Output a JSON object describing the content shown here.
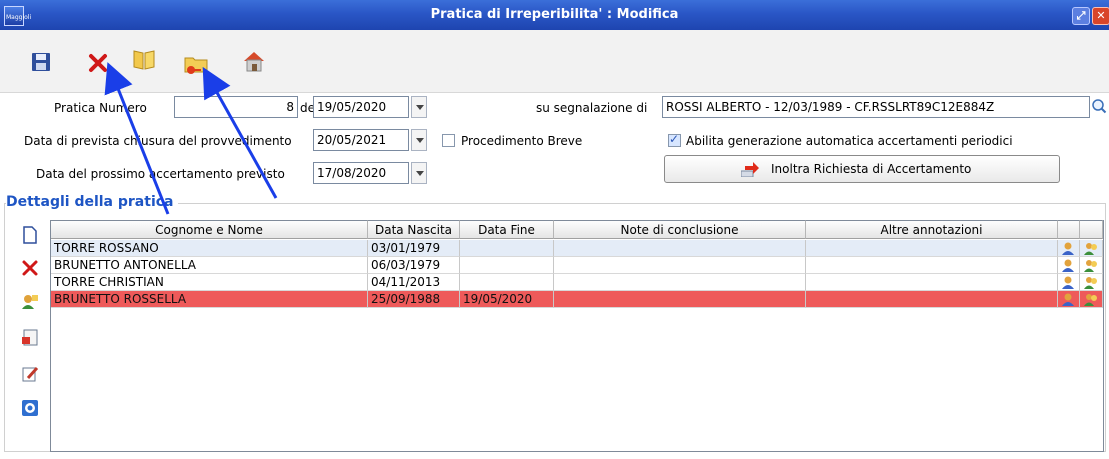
{
  "window": {
    "title": "Pratica di Irreperibilita' : Modifica",
    "app_icon_text": "Maggioli"
  },
  "toolbar": {
    "items": [
      {
        "name": "save-icon"
      },
      {
        "name": "delete-icon"
      },
      {
        "name": "open-book-icon"
      },
      {
        "name": "folder-key-icon"
      },
      {
        "name": "home-icon"
      }
    ]
  },
  "form": {
    "numero_label": "Pratica Numero",
    "numero_value": "8",
    "del_label": "del",
    "del_value": "19/05/2020",
    "segnalazione_label": "su segnalazione di",
    "segnalazione_value": "ROSSI ALBERTO - 12/03/1989 - CF.RSSLRT89C12E884Z",
    "chiusura_label": "Data di prevista chiusura del provvedimento",
    "chiusura_value": "20/05/2021",
    "breve_label": "Procedimento Breve",
    "breve_checked": false,
    "abilita_label": "Abilita generazione automatica accertamenti periodici",
    "abilita_checked": true,
    "prossimo_label": "Data del prossimo accertamento previsto",
    "prossimo_value": "17/08/2020",
    "inoltra_label": "Inoltra Richiesta di Accertamento"
  },
  "section": {
    "title": "Dettagli della pratica"
  },
  "grid": {
    "columns": [
      "Cognome e Nome",
      "Data Nascita",
      "Data Fine",
      "Note di conclusione",
      "Altre annotazioni"
    ],
    "rows": [
      {
        "nome": "TORRE ROSSANO",
        "nascita": "03/01/1979",
        "fine": "",
        "note": "",
        "altre": ""
      },
      {
        "nome": "BRUNETTO ANTONELLA",
        "nascita": "06/03/1979",
        "fine": "",
        "note": "",
        "altre": ""
      },
      {
        "nome": "TORRE CHRISTIAN",
        "nascita": "04/11/2013",
        "fine": "",
        "note": "",
        "altre": ""
      },
      {
        "nome": "BRUNETTO ROSSELLA",
        "nascita": "25/09/1988",
        "fine": "19/05/2020",
        "note": "",
        "altre": ""
      }
    ],
    "selected_row": 0,
    "highlighted_row": 3,
    "highlight_color": "#ee5a5a"
  },
  "side_toolbar": [
    "new-document-icon",
    "delete-icon",
    "person-edit-icon",
    "export-icon",
    "edit-icon",
    "info-icon"
  ],
  "annotation_color": "#1a3ee8"
}
